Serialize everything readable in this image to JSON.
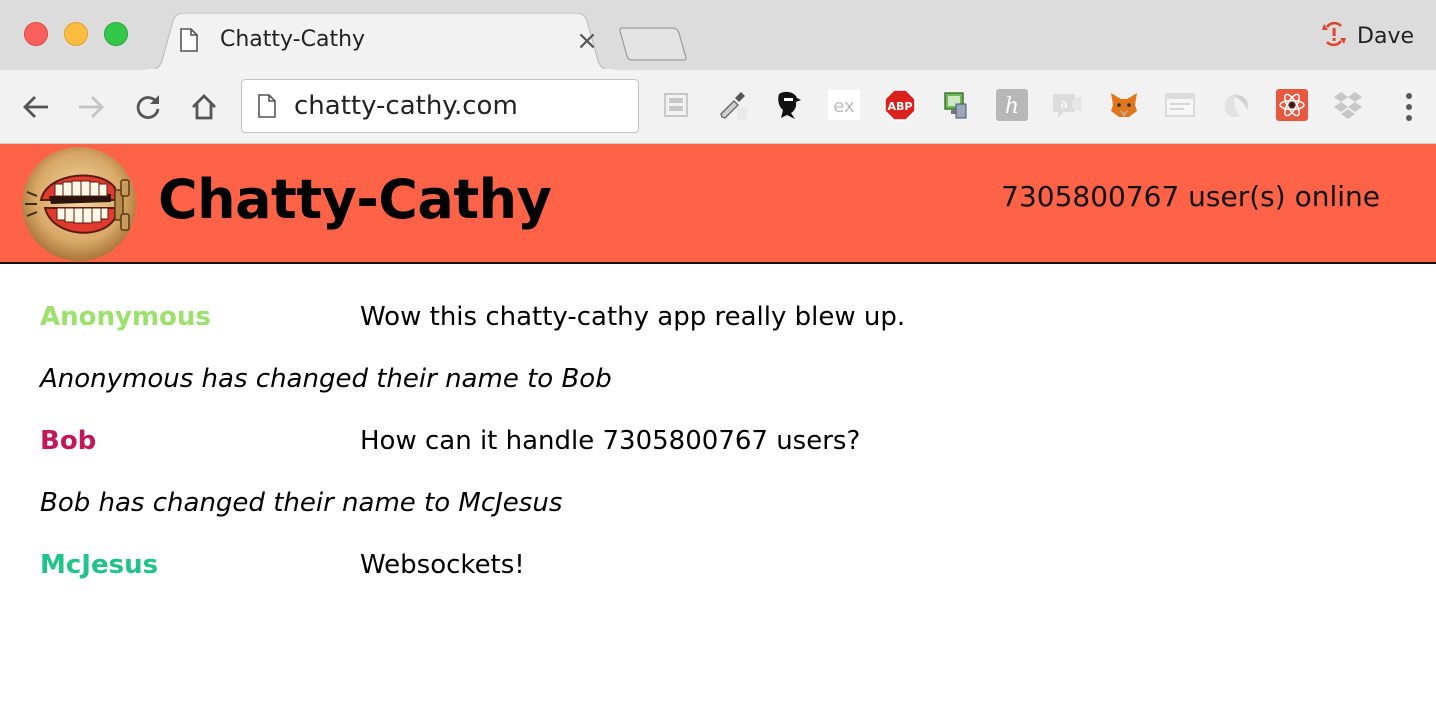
{
  "browser": {
    "tab_title": "Chatty-Cathy",
    "tab_close_glyph": "×",
    "profile_name": "Dave",
    "url": "chatty-cathy.com",
    "nav": {
      "back_icon": "back-arrow-icon",
      "forward_icon": "forward-arrow-icon",
      "reload_icon": "reload-icon",
      "home_icon": "home-icon"
    },
    "extensions": [
      "layout-extension-icon",
      "eyedropper-extension-icon",
      "ninja-extension-icon",
      "ex-extension-icon",
      "adblock-plus-icon",
      "screen-capture-extension-icon",
      "h-extension-icon",
      "chat-extension-icon",
      "metamask-fox-icon",
      "webpage-extension-icon",
      "swirl-extension-icon",
      "react-devtools-icon",
      "dropbox-icon"
    ],
    "colors": {
      "profile_sync_error": "#e0452b",
      "adblock_red": "#d9211d",
      "react_bg": "#e8583f"
    }
  },
  "app": {
    "title": "Chatty-Cathy",
    "online_count": "7305800767 user(s) online",
    "header_color": "#ff6347"
  },
  "messages": [
    {
      "type": "message",
      "username": "Anonymous",
      "content": "Wow this chatty-cathy app really blew up.",
      "color": "#9be26a"
    },
    {
      "type": "notification",
      "content": "Anonymous has changed their name to Bob"
    },
    {
      "type": "message",
      "username": "Bob",
      "content": "How can it handle 7305800767 users?",
      "color": "#c2185b"
    },
    {
      "type": "notification",
      "content": "Bob has changed their name to McJesus"
    },
    {
      "type": "message",
      "username": "McJesus",
      "content": "Websockets!",
      "color": "#1fc48a"
    }
  ]
}
